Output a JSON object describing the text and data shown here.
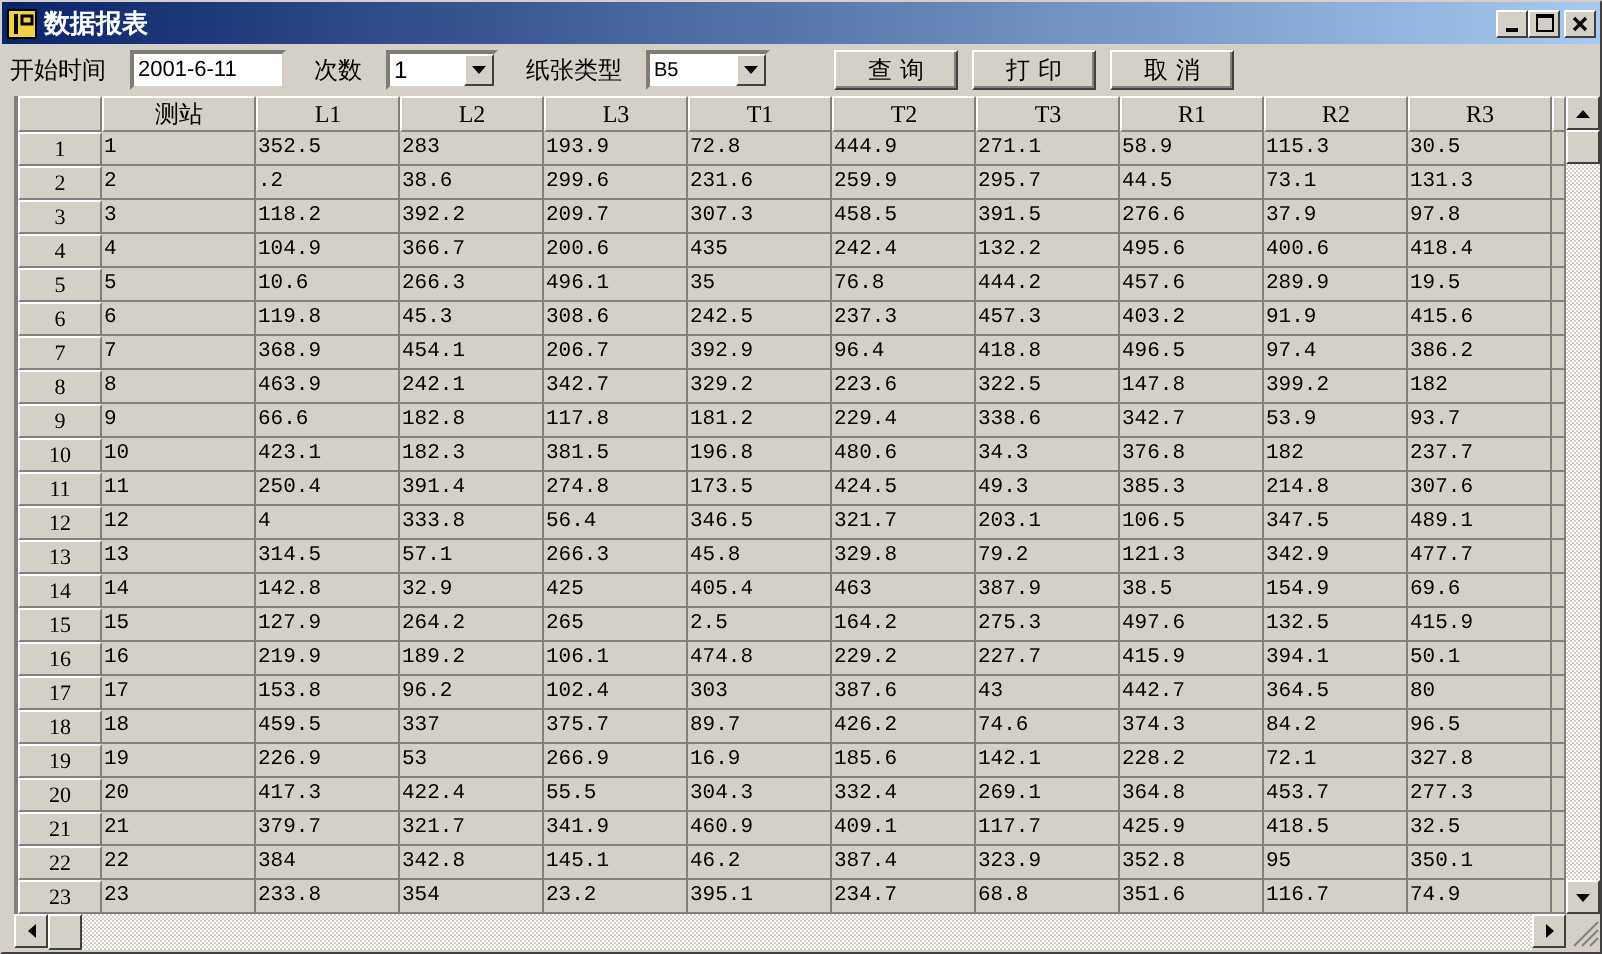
{
  "window": {
    "title": "数据报表"
  },
  "toolbar": {
    "start_label": "开始时间",
    "start_value": "2001-6-11",
    "count_label": "次数",
    "count_value": "1",
    "paper_label": "纸张类型",
    "paper_value": "B5",
    "buttons": [
      "查 询",
      "打 印",
      "取 消"
    ]
  },
  "table": {
    "columns": [
      "测站",
      "L1",
      "L2",
      "L3",
      "T1",
      "T2",
      "T3",
      "R1",
      "R2",
      "R3"
    ],
    "rows": [
      {
        "header": "1",
        "cells": [
          "1",
          "352.5",
          "283",
          "193.9",
          "72.8",
          "444.9",
          "271.1",
          "58.9",
          "115.3",
          "30.5"
        ]
      },
      {
        "header": "2",
        "cells": [
          "2",
          ".2",
          "38.6",
          "299.6",
          "231.6",
          "259.9",
          "295.7",
          "44.5",
          "73.1",
          "131.3"
        ]
      },
      {
        "header": "3",
        "cells": [
          "3",
          "118.2",
          "392.2",
          "209.7",
          "307.3",
          "458.5",
          "391.5",
          "276.6",
          "37.9",
          "97.8"
        ]
      },
      {
        "header": "4",
        "cells": [
          "4",
          "104.9",
          "366.7",
          "200.6",
          "435",
          "242.4",
          "132.2",
          "495.6",
          "400.6",
          "418.4"
        ]
      },
      {
        "header": "5",
        "cells": [
          "5",
          "10.6",
          "266.3",
          "496.1",
          "35",
          "76.8",
          "444.2",
          "457.6",
          "289.9",
          "19.5"
        ]
      },
      {
        "header": "6",
        "cells": [
          "6",
          "119.8",
          "45.3",
          "308.6",
          "242.5",
          "237.3",
          "457.3",
          "403.2",
          "91.9",
          "415.6"
        ]
      },
      {
        "header": "7",
        "cells": [
          "7",
          "368.9",
          "454.1",
          "206.7",
          "392.9",
          "96.4",
          "418.8",
          "496.5",
          "97.4",
          "386.2"
        ]
      },
      {
        "header": "8",
        "cells": [
          "8",
          "463.9",
          "242.1",
          "342.7",
          "329.2",
          "223.6",
          "322.5",
          "147.8",
          "399.2",
          "182"
        ]
      },
      {
        "header": "9",
        "cells": [
          "9",
          "66.6",
          "182.8",
          "117.8",
          "181.2",
          "229.4",
          "338.6",
          "342.7",
          "53.9",
          "93.7"
        ]
      },
      {
        "header": "10",
        "cells": [
          "10",
          "423.1",
          "182.3",
          "381.5",
          "196.8",
          "480.6",
          "34.3",
          "376.8",
          "182",
          "237.7"
        ]
      },
      {
        "header": "11",
        "cells": [
          "11",
          "250.4",
          "391.4",
          "274.8",
          "173.5",
          "424.5",
          "49.3",
          "385.3",
          "214.8",
          "307.6"
        ]
      },
      {
        "header": "12",
        "cells": [
          "12",
          "4",
          "333.8",
          "56.4",
          "346.5",
          "321.7",
          "203.1",
          "106.5",
          "347.5",
          "489.1"
        ]
      },
      {
        "header": "13",
        "cells": [
          "13",
          "314.5",
          "57.1",
          "266.3",
          "45.8",
          "329.8",
          "79.2",
          "121.3",
          "342.9",
          "477.7"
        ]
      },
      {
        "header": "14",
        "cells": [
          "14",
          "142.8",
          "32.9",
          "425",
          "405.4",
          "463",
          "387.9",
          "38.5",
          "154.9",
          "69.6"
        ]
      },
      {
        "header": "15",
        "cells": [
          "15",
          "127.9",
          "264.2",
          "265",
          "2.5",
          "164.2",
          "275.3",
          "497.6",
          "132.5",
          "415.9"
        ]
      },
      {
        "header": "16",
        "cells": [
          "16",
          "219.9",
          "189.2",
          "106.1",
          "474.8",
          "229.2",
          "227.7",
          "415.9",
          "394.1",
          "50.1"
        ]
      },
      {
        "header": "17",
        "cells": [
          "17",
          "153.8",
          "96.2",
          "102.4",
          "303",
          "387.6",
          "43",
          "442.7",
          "364.5",
          "80"
        ]
      },
      {
        "header": "18",
        "cells": [
          "18",
          "459.5",
          "337",
          "375.7",
          "89.7",
          "426.2",
          "74.6",
          "374.3",
          "84.2",
          "96.5"
        ]
      },
      {
        "header": "19",
        "cells": [
          "19",
          "226.9",
          "53",
          "266.9",
          "16.9",
          "185.6",
          "142.1",
          "228.2",
          "72.1",
          "327.8"
        ]
      },
      {
        "header": "20",
        "cells": [
          "20",
          "417.3",
          "422.4",
          "55.5",
          "304.3",
          "332.4",
          "269.1",
          "364.8",
          "453.7",
          "277.3"
        ]
      },
      {
        "header": "21",
        "cells": [
          "21",
          "379.7",
          "321.7",
          "341.9",
          "460.9",
          "409.1",
          "117.7",
          "425.9",
          "418.5",
          "32.5"
        ]
      },
      {
        "header": "22",
        "cells": [
          "22",
          "384",
          "342.8",
          "145.1",
          "46.2",
          "387.4",
          "323.9",
          "352.8",
          "95",
          "350.1"
        ]
      },
      {
        "header": "23",
        "cells": [
          "23",
          "233.8",
          "354",
          "23.2",
          "395.1",
          "234.7",
          "68.8",
          "351.6",
          "116.7",
          "74.9"
        ]
      }
    ]
  }
}
